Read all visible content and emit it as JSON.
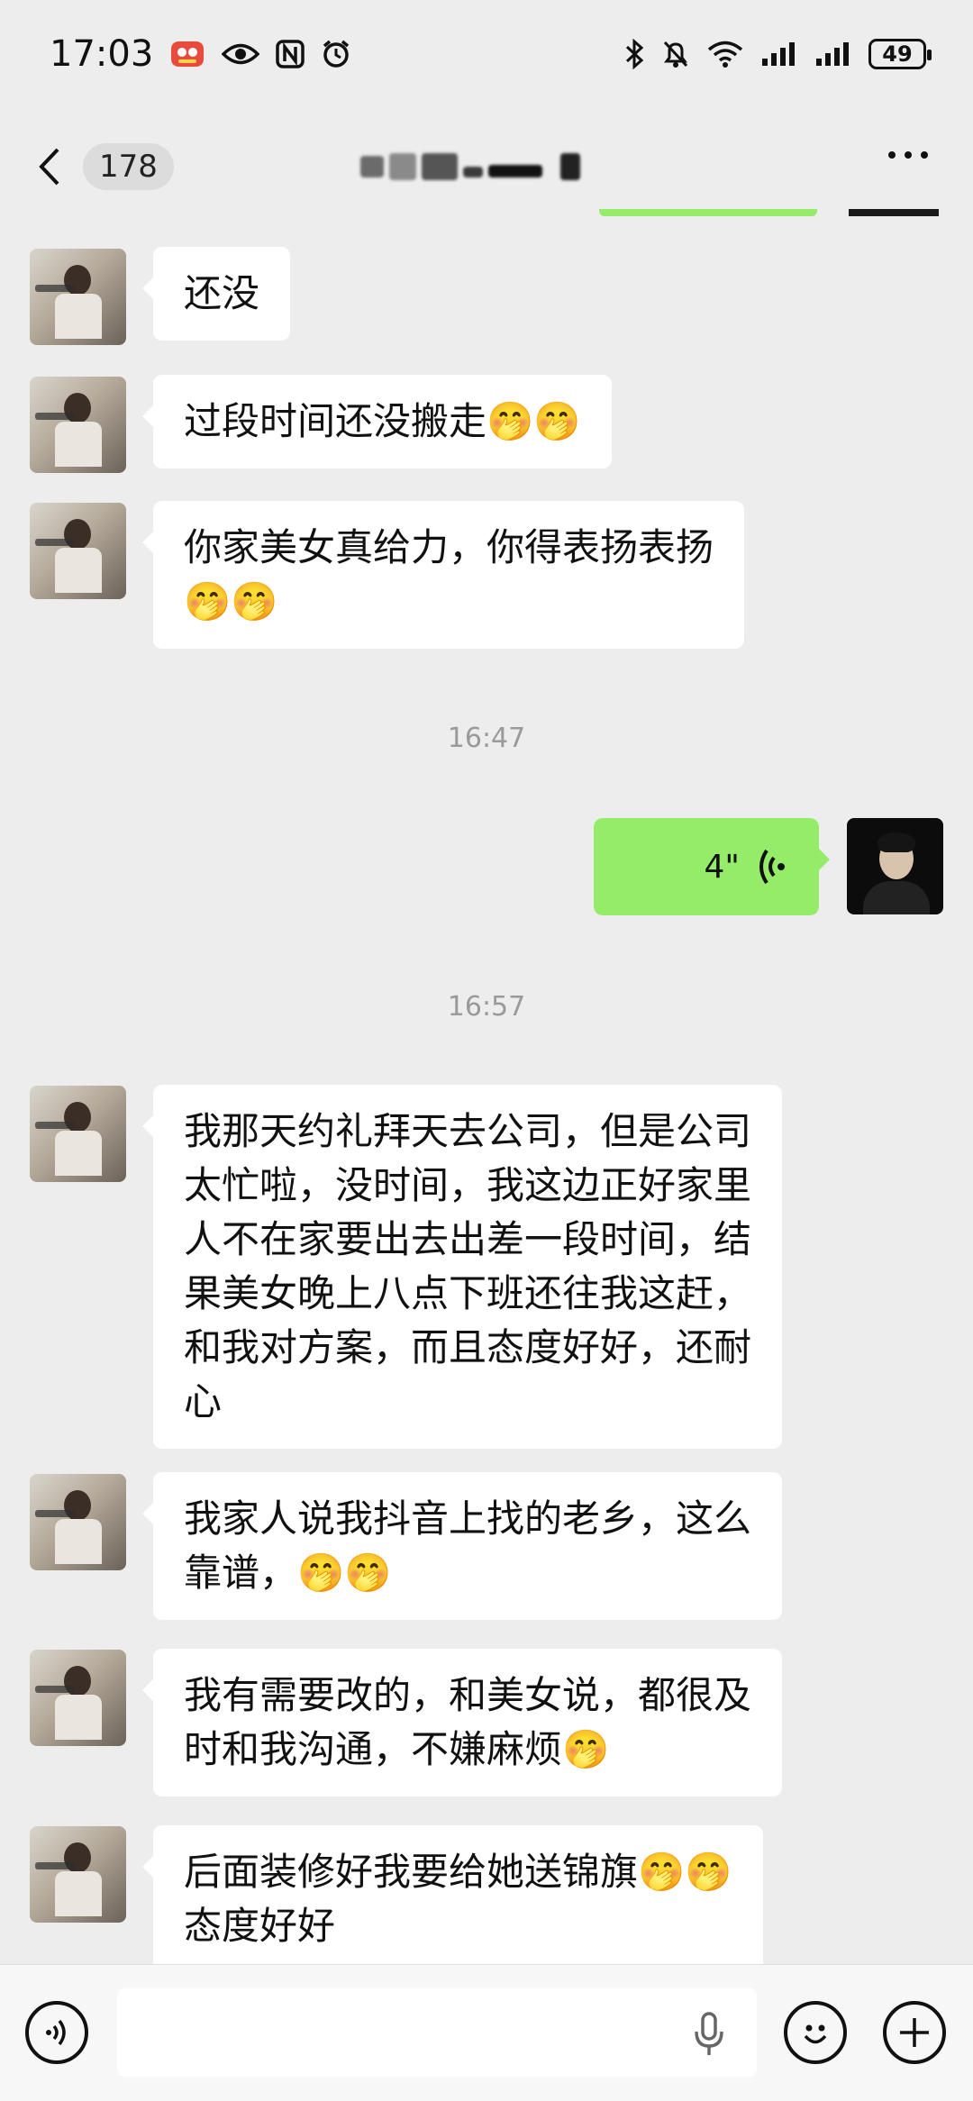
{
  "status_bar": {
    "time": "17:03",
    "battery": "49"
  },
  "header": {
    "unread_count": "178",
    "title": ""
  },
  "messages": [
    {
      "text": "还没"
    },
    {
      "text": "过段时间还没搬走🤭🤭"
    },
    {
      "text": "你家美女真给力，你得表扬表扬\n🤭🤭"
    },
    {
      "timestamp": "16:47"
    },
    {
      "voice_duration": "4\""
    },
    {
      "timestamp": "16:57"
    },
    {
      "text": "我那天约礼拜天去公司，但是公司\n太忙啦，没时间，我这边正好家里\n人不在家要出去出差一段时间，结\n果美女晚上八点下班还往我这赶，\n和我对方案，而且态度好好，还耐\n心"
    },
    {
      "text": "我家人说我抖音上找的老乡，这么\n靠谱，🤭🤭"
    },
    {
      "text": "我有需要改的，和美女说，都很及\n时和我沟通，不嫌麻烦🤭"
    },
    {
      "text": "后面装修好我要给她送锦旗🤭🤭\n态度好好"
    }
  ],
  "colors": {
    "my_bubble": "#95ec69",
    "their_bubble": "#ffffff",
    "background": "#ededed"
  }
}
